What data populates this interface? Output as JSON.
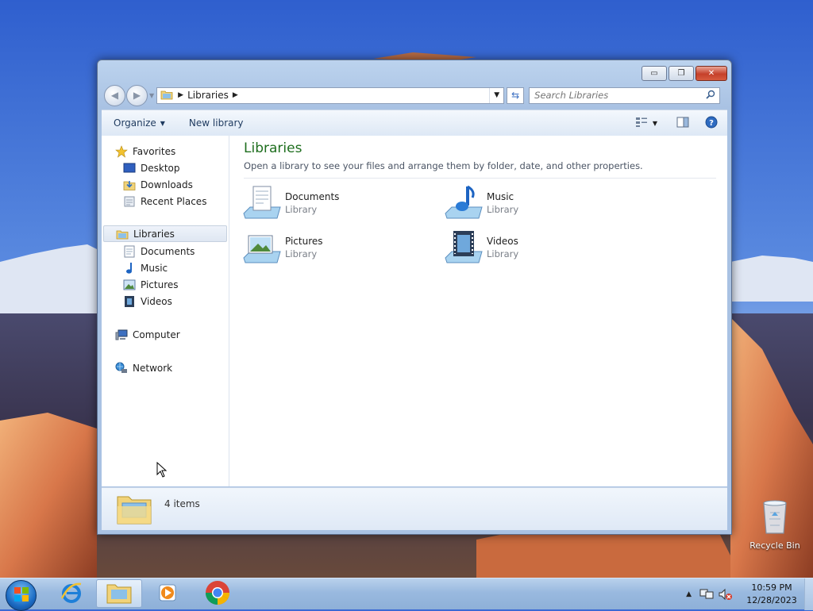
{
  "window": {
    "buttons": {
      "minimize": "▭",
      "maximize": "❐",
      "close": "✕"
    }
  },
  "address": {
    "crumbs": [
      "Libraries"
    ],
    "search_placeholder": "Search Libraries"
  },
  "toolbar": {
    "organize_label": "Organize",
    "new_library_label": "New library"
  },
  "navpane": {
    "favorites": {
      "label": "Favorites",
      "items": [
        "Desktop",
        "Downloads",
        "Recent Places"
      ]
    },
    "libraries": {
      "label": "Libraries",
      "items": [
        "Documents",
        "Music",
        "Pictures",
        "Videos"
      ]
    },
    "computer_label": "Computer",
    "network_label": "Network"
  },
  "main": {
    "title": "Libraries",
    "subtitle": "Open a library to see your files and arrange them by folder, date, and other properties.",
    "libraries": [
      {
        "name": "Documents",
        "kind": "Library",
        "icon": "documents-library-icon"
      },
      {
        "name": "Music",
        "kind": "Library",
        "icon": "music-library-icon"
      },
      {
        "name": "Pictures",
        "kind": "Library",
        "icon": "pictures-library-icon"
      },
      {
        "name": "Videos",
        "kind": "Library",
        "icon": "videos-library-icon"
      }
    ]
  },
  "details": {
    "count": "4 items"
  },
  "desktop": {
    "recycle_bin_label": "Recycle Bin"
  },
  "taskbar": {
    "apps": [
      "internet-explorer-icon",
      "windows-explorer-icon",
      "windows-media-player-icon",
      "chrome-icon"
    ],
    "active_app": "windows-explorer-icon",
    "time": "10:59 PM",
    "date": "12/28/2023"
  },
  "colors": {
    "title_green": "#1e6e1e",
    "sky": "#3a6ad4",
    "taskbar": "#99b9df"
  }
}
